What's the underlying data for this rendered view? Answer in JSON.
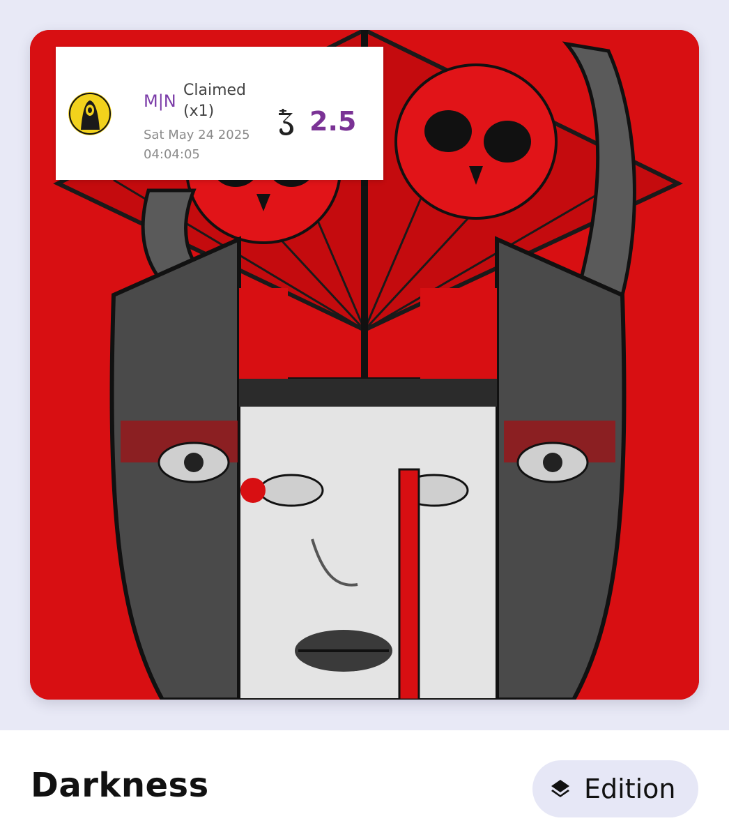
{
  "sale": {
    "user_name": "M|N",
    "action": "Claimed (x1)",
    "timestamp": "Sat May 24 2025 04:04:05",
    "currency_icon": "tezos-icon",
    "price": "2.5",
    "price_color": "#7a3295",
    "user_color": "#7b3ca8"
  },
  "artwork": {
    "title": "Darkness",
    "image": "red-skull-mask-artwork",
    "background_color": "#d80f12"
  },
  "edition_badge": {
    "icon": "layers-icon",
    "label": "Edition"
  }
}
